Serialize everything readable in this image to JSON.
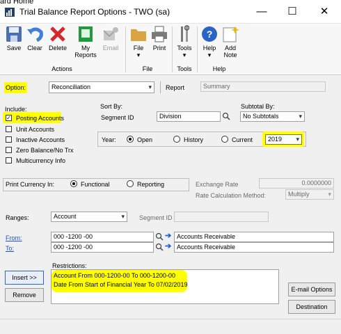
{
  "window": {
    "top_remnant": "ard Home",
    "title": "Trial Balance Report Options  -  TWO (sa)",
    "min_label": "—",
    "max_label": "☐",
    "close_label": "✕"
  },
  "ribbon": {
    "save": "Save",
    "clear": "Clear",
    "delete": "Delete",
    "my_reports_1": "My",
    "my_reports_2": "Reports",
    "email": "Email",
    "file": "File",
    "print": "Print",
    "tools": "Tools",
    "help": "Help",
    "add_note_1": "Add",
    "add_note_2": "Note",
    "groups": {
      "actions": "Actions",
      "file": "File",
      "tools": "Tools",
      "help": "Help"
    }
  },
  "form": {
    "option_label": "Option:",
    "option_value": "Reconciliation",
    "report_label": "Report",
    "report_value": "Summary",
    "include_label": "Include:",
    "include_items": [
      {
        "label": "Posting Accounts",
        "checked": true
      },
      {
        "label": "Unit Accounts",
        "checked": false
      },
      {
        "label": "Inactive Accounts",
        "checked": false
      },
      {
        "label": "Zero Balance/No Trx",
        "checked": false
      },
      {
        "label": "Multicurrency Info",
        "checked": false
      }
    ],
    "sort_by_label": "Sort By:",
    "segment_id_label": "Segment ID",
    "segment_value": "Division",
    "subtotal_label": "Subtotal By:",
    "subtotal_value": "No Subtotals",
    "year_label": "Year:",
    "year_open": "Open",
    "year_history": "History",
    "year_current": "Current",
    "year_value": "2019",
    "print_currency_label": "Print Currency In:",
    "functional": "Functional",
    "reporting": "Reporting",
    "exchange_rate_label": "Exchange Rate",
    "exchange_rate_value": "0.0000000",
    "rate_calc_label": "Rate Calculation Method:",
    "rate_calc_value": "Multiply",
    "ranges_label": "Ranges:",
    "ranges_value": "Account",
    "ranges_segment_label": "Segment ID",
    "from_label": "From:",
    "from_value": "000 -1200 -00",
    "from_desc": "Accounts Receivable",
    "to_label": "To:",
    "to_value": "000 -1200 -00",
    "to_desc": "Accounts Receivable",
    "insert_button": "Insert >>",
    "remove_button": "Remove",
    "restrictions_label": "Restrictions:",
    "restrictions": [
      "Account From 000-1200-00 To 000-1200-00",
      "Date From Start of Financial Year To 07/02/2019"
    ],
    "email_options_button": "E-mail Options",
    "destination_button": "Destination"
  }
}
